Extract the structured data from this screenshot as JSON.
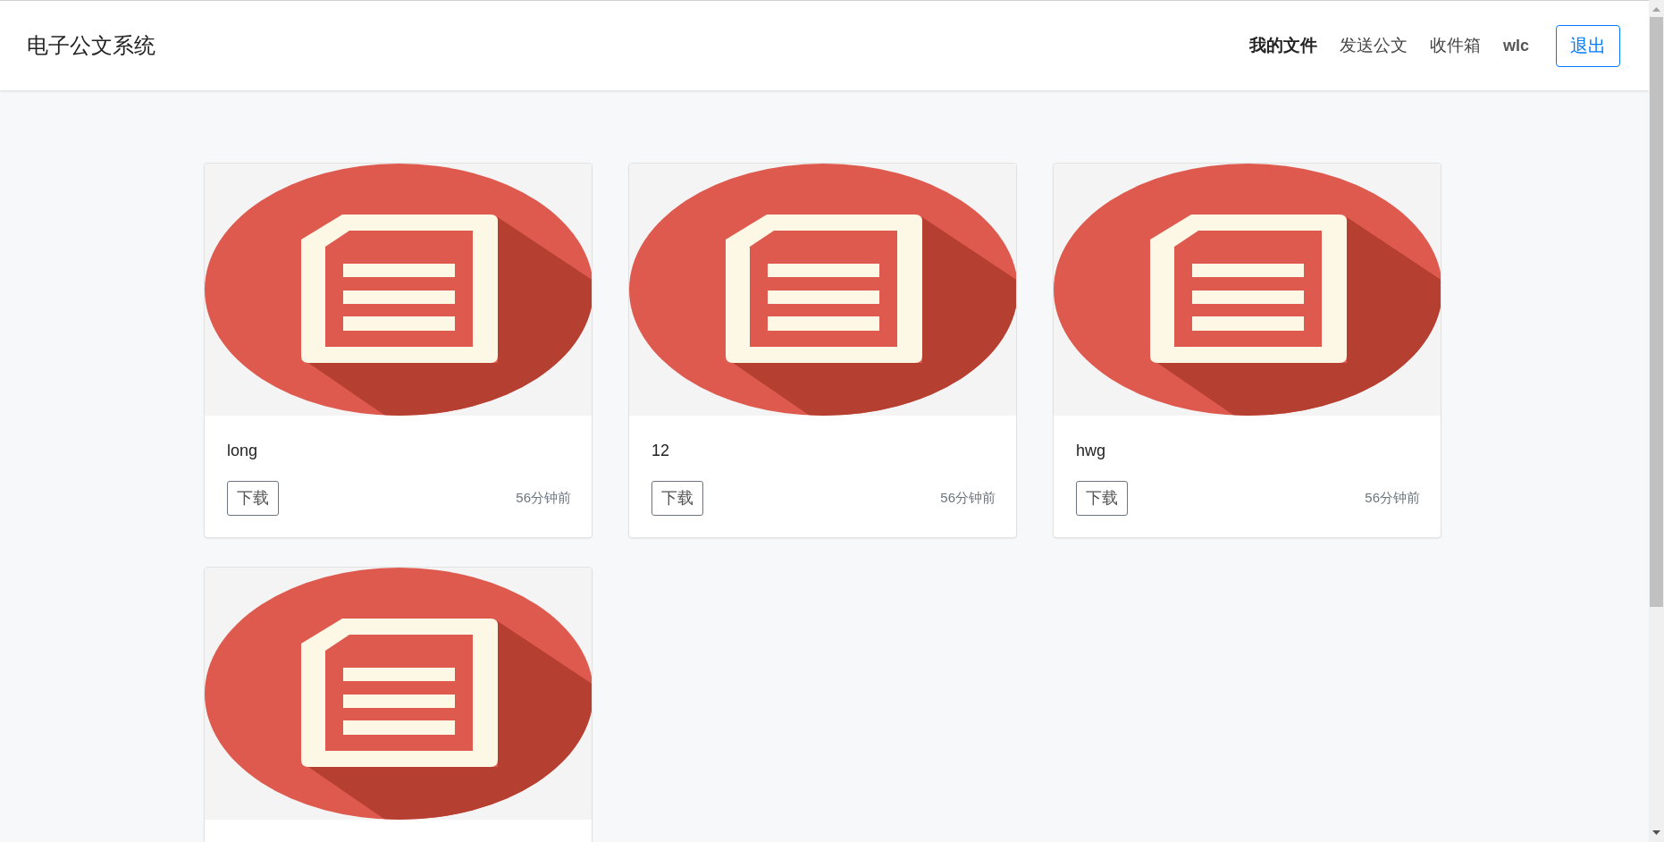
{
  "brand": "电子公文系统",
  "nav": [
    {
      "label": "我的文件",
      "selected": true
    },
    {
      "label": "发送公文",
      "selected": false
    },
    {
      "label": "收件箱",
      "selected": false
    }
  ],
  "user": "wlc",
  "logout": "退出",
  "files": [
    {
      "kind": "full",
      "name": "long",
      "download": "下载",
      "time": "56分钟前"
    },
    {
      "kind": "full",
      "name": "12",
      "download": "下载",
      "time": "56分钟前"
    },
    {
      "kind": "full",
      "name": "hwg",
      "download": "下载",
      "time": "56分钟前"
    },
    {
      "kind": "cut"
    }
  ]
}
